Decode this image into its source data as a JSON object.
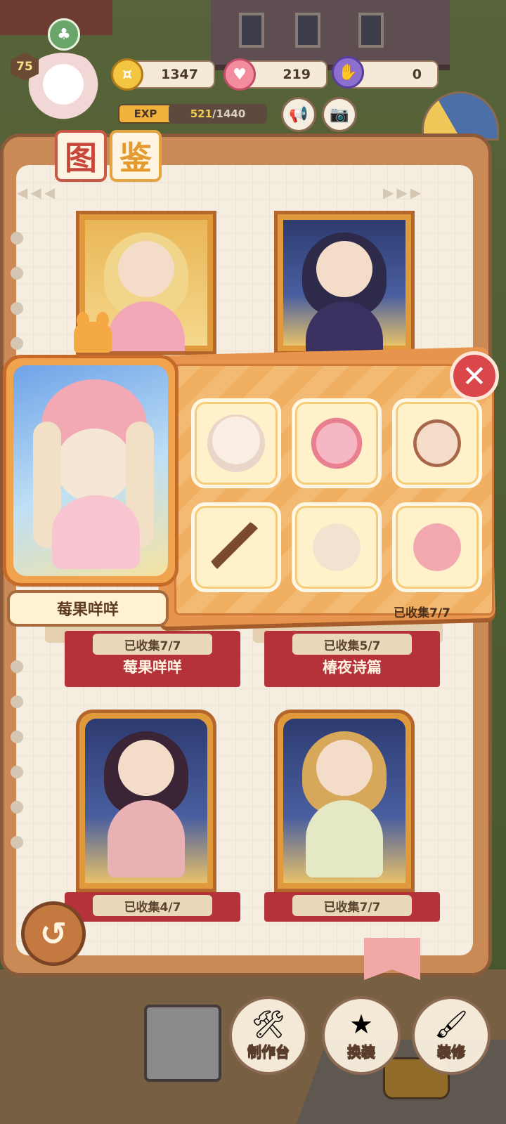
{
  "hud": {
    "level": "75",
    "coins": "1347",
    "hearts": "219",
    "gems": "0",
    "exp_label": "EXP",
    "exp_current": "521",
    "exp_max": "/1440"
  },
  "page": {
    "title_chars": [
      "图",
      "鉴"
    ]
  },
  "cards": [
    {
      "name": "莓果咩咩",
      "collected": "已收集7/7"
    },
    {
      "name": "椿夜诗篇",
      "collected": "已收集5/7"
    },
    {
      "collected": "已收集4/7"
    },
    {
      "collected": "已收集7/7"
    }
  ],
  "popup": {
    "outfit_name": "莓果咩咩",
    "collected": "已收集7/7",
    "close_glyph": "✕",
    "items": [
      "face-icon",
      "dress-icon",
      "body-icon",
      "staff-icon",
      "hair-icon",
      "bonnet-icon"
    ]
  },
  "bottom_actions": [
    {
      "label": "制作台",
      "icon": "workbench-icon"
    },
    {
      "label": "换装",
      "icon": "dressup-icon"
    },
    {
      "label": "装修",
      "icon": "decorate-icon"
    }
  ],
  "colors": {
    "accent": "#c8473c",
    "card_frame": "#e09a3c",
    "banner": "#b5323b",
    "close": "#d9474a"
  }
}
